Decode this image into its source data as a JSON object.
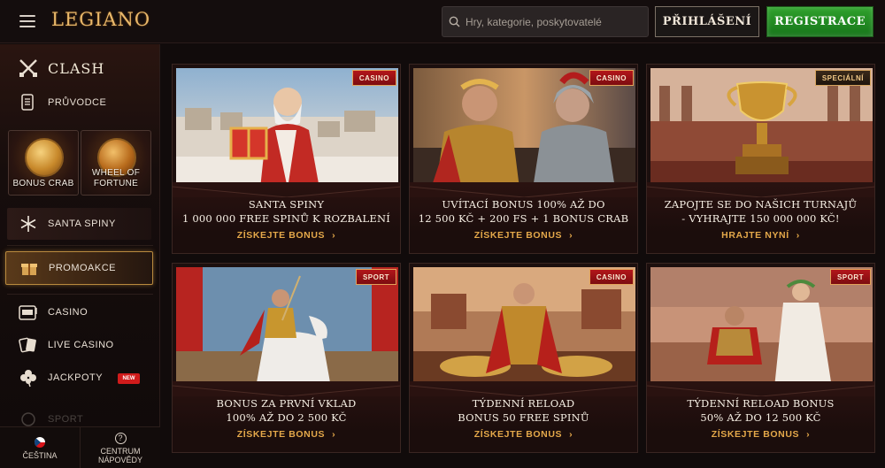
{
  "header": {
    "logo": "LEGIANO",
    "search_placeholder": "Hry, kategorie, poskytovatelé",
    "login_label": "PŘIHLÁŠENÍ",
    "register_label": "REGISTRACE"
  },
  "sidebar": {
    "clash": "CLASH",
    "guide": "PRŮVODCE",
    "tiles": [
      {
        "label": "BONUS CRAB"
      },
      {
        "label": "WHEEL OF FORTUNE"
      }
    ],
    "santa": "SANTA SPINY",
    "promo": "PROMOAKCE",
    "items": [
      {
        "label": "CASINO"
      },
      {
        "label": "LIVE CASINO"
      },
      {
        "label": "JACKPOTY"
      }
    ],
    "new_badge": "NEW",
    "faded_item": "SPORT",
    "bottom": {
      "language": "ČEŠTINA",
      "help": "CENTRUM NÁPOVĚDY"
    }
  },
  "cards": [
    {
      "tag": "CASINO",
      "title_1": "SANTA SPINY",
      "title_2": "1 000 000 FREE SPINŮ K ROZBALENÍ",
      "cta": "ZÍSKEJTE BONUS"
    },
    {
      "tag": "CASINO",
      "title_1": "UVÍTACÍ BONUS 100% AŽ DO",
      "title_2": "12 500 KČ + 200 FS + 1 BONUS CRAB",
      "cta": "ZÍSKEJTE BONUS"
    },
    {
      "tag": "SPECIÁLNÍ",
      "title_1": "ZAPOJTE SE DO NAŠICH TURNAJŮ",
      "title_2": "- VYHRAJTE 150 000 000 KČ!",
      "cta": "HRAJTE NYNÍ"
    },
    {
      "tag": "SPORT",
      "title_1": "BONUS ZA PRVNÍ VKLAD",
      "title_2": "100% AŽ DO 2 500 KČ",
      "cta": "ZÍSKEJTE BONUS"
    },
    {
      "tag": "CASINO",
      "title_1": "TÝDENNÍ RELOAD",
      "title_2": "BONUS 50 FREE SPINŮ",
      "cta": "ZÍSKEJTE BONUS"
    },
    {
      "tag": "SPORT",
      "title_1": "TÝDENNÍ RELOAD BONUS",
      "title_2": "50% AŽ DO 12 500 KČ",
      "cta": "ZÍSKEJTE BONUS"
    }
  ],
  "colors": {
    "accent_gold": "#e4a84a",
    "register_green": "#2fa22c",
    "tag_red": "#b3161a",
    "new_red": "#d01b1b"
  },
  "icons": {
    "menu": "hamburger-icon",
    "search": "search-icon",
    "clash": "crossed-swords-icon",
    "guide": "scroll-icon",
    "santa": "snowflake-icon",
    "promo": "gift-icon",
    "casino": "slot-machine-icon",
    "live_casino": "cards-icon",
    "jackpot": "clover-icon",
    "language": "czech-flag-icon",
    "help": "question-icon",
    "cta": "chevron-right-icon"
  }
}
